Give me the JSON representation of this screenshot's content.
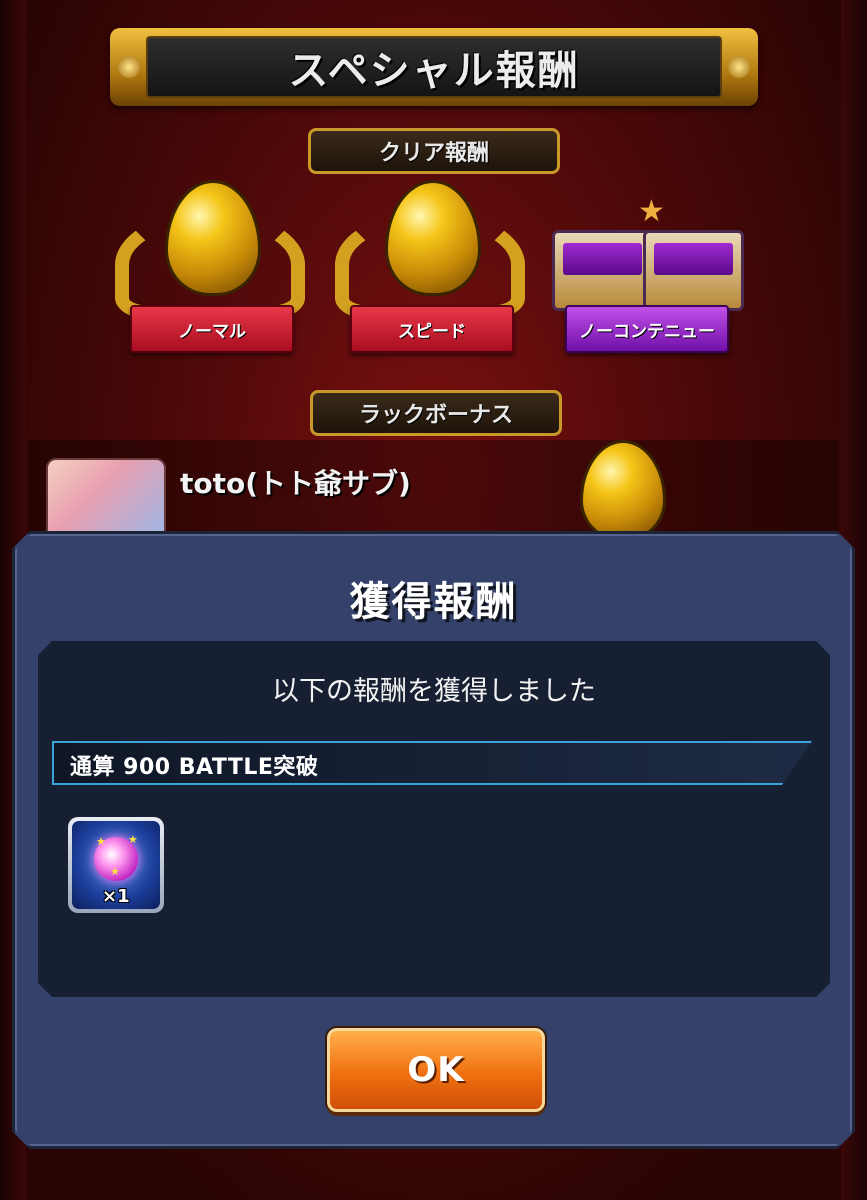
{
  "header": {
    "title": "スペシャル報酬"
  },
  "clear_rewards": {
    "label": "クリア報酬",
    "items": [
      {
        "label": "ノーマル",
        "icon": "egg-icon",
        "ribbon_color": "#d01e30"
      },
      {
        "label": "スピード",
        "icon": "egg-icon",
        "ribbon_color": "#d01e30"
      },
      {
        "label": "ノーコンテニュー",
        "icon": "treasure-chest-icon",
        "ribbon_color": "#9a22d0"
      }
    ]
  },
  "luck_bonus": {
    "label": "ラックボーナス",
    "player_name": "toto(トト爺サブ)"
  },
  "modal": {
    "title": "獲得報酬",
    "message": "以下の報酬を獲得しました",
    "milestone": "通算 900 BATTLE突破",
    "reward_item": {
      "icon": "orb-icon",
      "count": "×1"
    },
    "ok_label": "OK"
  },
  "colors": {
    "modal_bg": "#34416a",
    "panel_bg": "#172032",
    "ok_button": "#f07010",
    "accent_gold": "#d4a020"
  }
}
